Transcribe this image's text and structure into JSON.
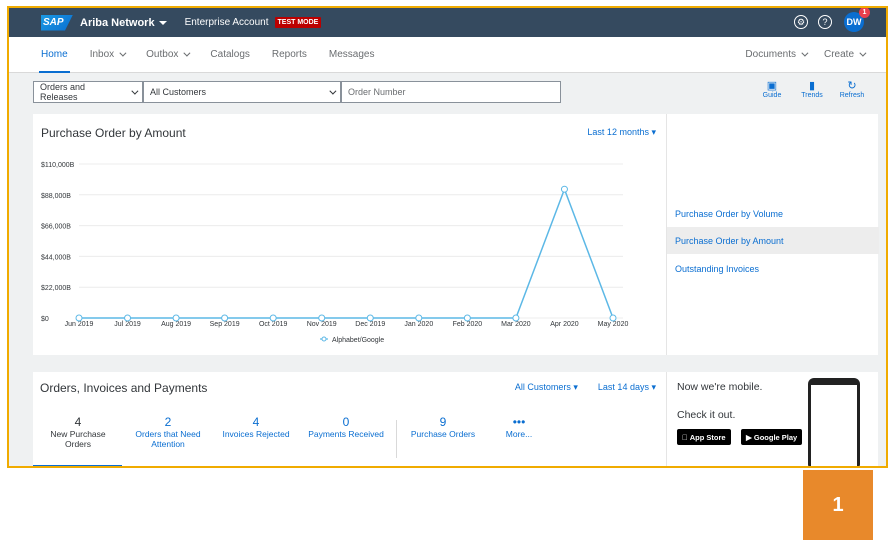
{
  "topbar": {
    "logo": "SAP",
    "product": "Ariba Network",
    "account": "Enterprise Account",
    "test_mode": "TEST MODE",
    "avatar": "DW",
    "notification_count": "1",
    "settings_icon": "gear-icon",
    "help_icon": "help-icon"
  },
  "nav": {
    "items": [
      "Home",
      "Inbox",
      "Outbox",
      "Catalogs",
      "Reports",
      "Messages"
    ],
    "right": [
      "Documents",
      "Create"
    ]
  },
  "filters": {
    "doc_type": "Orders and Releases",
    "customer": "All Customers",
    "order_placeholder": "Order Number"
  },
  "tools": [
    "Guide",
    "Trends",
    "Refresh"
  ],
  "chart_card": {
    "title": "Purchase Order by Amount",
    "period": "Last 12 months"
  },
  "chart_data": {
    "type": "line",
    "title": "Purchase Order by Amount",
    "categories": [
      "Jun 2019",
      "Jul 2019",
      "Aug 2019",
      "Sep 2019",
      "Oct 2019",
      "Nov 2019",
      "Dec 2019",
      "Jan 2020",
      "Feb 2020",
      "Mar 2020",
      "Apr 2020",
      "May 2020"
    ],
    "series": [
      {
        "name": "Alphabet/Google",
        "values": [
          0,
          0,
          0,
          0,
          0,
          0,
          0,
          0,
          0,
          0,
          92000,
          0
        ]
      }
    ],
    "yticks": [
      "$0",
      "$22,000B",
      "$44,000B",
      "$66,000B",
      "$88,000B",
      "$110,000B"
    ],
    "ylim": [
      0,
      110000
    ],
    "color": "#5cb8e6",
    "legend": "bottom"
  },
  "side_links": [
    "Purchase Order by Volume",
    "Purchase Order by Amount",
    "Outstanding Invoices"
  ],
  "bottom_card": {
    "title": "Orders, Invoices and Payments",
    "customers": "All Customers",
    "period": "Last 14 days",
    "stats": [
      {
        "num": "4",
        "label": "New Purchase Orders"
      },
      {
        "num": "2",
        "label": "Orders that Need Attention"
      },
      {
        "num": "4",
        "label": "Invoices Rejected"
      },
      {
        "num": "0",
        "label": "Payments Received"
      },
      {
        "num": "9",
        "label": "Purchase Orders"
      },
      {
        "num": "•••",
        "label": "More..."
      }
    ]
  },
  "mobile": {
    "line1": "Now we're mobile.",
    "line2": "Check it out.",
    "app_store": "App Store",
    "google_play": "Google Play"
  },
  "step_badge": "1"
}
